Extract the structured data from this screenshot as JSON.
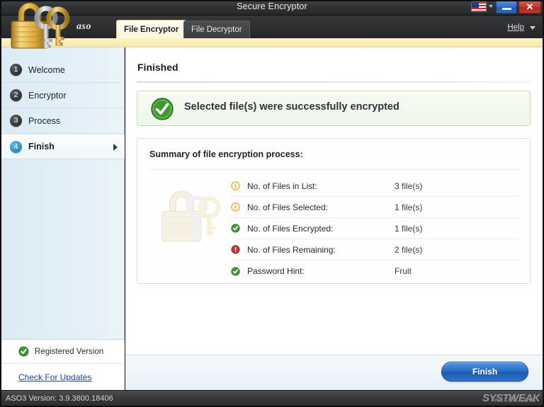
{
  "window": {
    "title": "Secure Encryptor",
    "minimize_label": "minimize",
    "close_label": "✕",
    "language_icon": "us-flag-icon"
  },
  "tabs": {
    "brand": "aso",
    "items": [
      {
        "label": "File Encryptor",
        "active": true
      },
      {
        "label": "File Decryptor",
        "active": false
      }
    ],
    "help_label": "Help"
  },
  "sidebar": {
    "items": [
      {
        "num": "1",
        "label": "Welcome",
        "active": false
      },
      {
        "num": "2",
        "label": "Encryptor",
        "active": false
      },
      {
        "num": "3",
        "label": "Process",
        "active": false
      },
      {
        "num": "4",
        "label": "Finish",
        "active": true
      }
    ],
    "registered_label": "Registered Version",
    "update_link": "Check For Updates"
  },
  "main": {
    "page_title": "Finished",
    "banner_text": "Selected file(s) were successfully encrypted",
    "summary_title": "Summary of file encryption process:",
    "rows": [
      {
        "icon": "info-icon",
        "label": "No. of Files in List:",
        "value": "3 file(s)"
      },
      {
        "icon": "info-icon",
        "label": "No. of Files Selected:",
        "value": "1 file(s)"
      },
      {
        "icon": "success-icon",
        "label": "No. of Files Encrypted:",
        "value": "1 file(s)"
      },
      {
        "icon": "error-icon",
        "label": "No. of Files Remaining:",
        "value": "2 file(s)"
      },
      {
        "icon": "success-icon",
        "label": "Password Hint:",
        "value": "Fruit"
      }
    ]
  },
  "footer": {
    "finish_button": "Finish"
  },
  "statusbar": {
    "version_text": "ASO3 Version: 3.9.3800.18406",
    "watermark": "SYSTWEAK",
    "watermark_sub": "wsxdn.com"
  },
  "colors": {
    "accent_blue": "#2a6fc4",
    "success_green": "#3f9a30",
    "info_orange": "#e0a52a",
    "error_red": "#c0392e",
    "tab_yellow": "#fdf3c5",
    "sidebar_blue": "#e2eff6"
  }
}
